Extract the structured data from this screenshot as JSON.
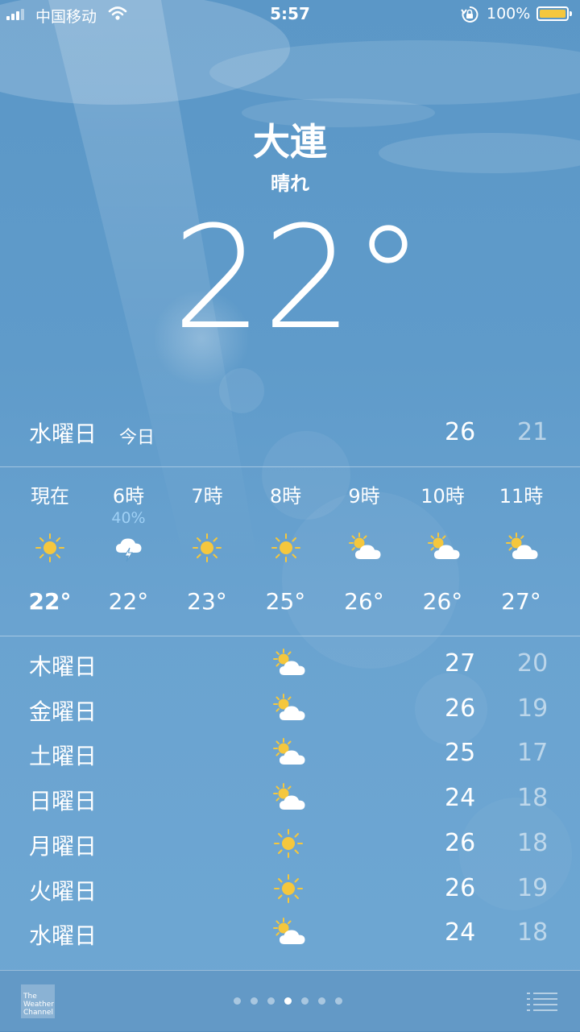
{
  "status_bar": {
    "carrier": "中国移动",
    "time": "5:57",
    "battery_percent": "100%",
    "battery_color": "#f5c73d"
  },
  "location": {
    "city": "大連",
    "condition": "晴れ",
    "temperature": "22°"
  },
  "today": {
    "day": "水曜日",
    "label": "今日",
    "high": "26",
    "low": "21"
  },
  "hourly": [
    {
      "label": "現在",
      "precip": "",
      "icon": "sun-icon",
      "temp": "22°"
    },
    {
      "label": "6時",
      "precip": "40%",
      "icon": "thunderstorm-icon",
      "temp": "22°"
    },
    {
      "label": "7時",
      "precip": "",
      "icon": "sun-icon",
      "temp": "23°"
    },
    {
      "label": "8時",
      "precip": "",
      "icon": "sun-icon",
      "temp": "25°"
    },
    {
      "label": "9時",
      "precip": "",
      "icon": "partly-cloudy-icon",
      "temp": "26°"
    },
    {
      "label": "10時",
      "precip": "",
      "icon": "partly-cloudy-icon",
      "temp": "26°"
    },
    {
      "label": "11時",
      "precip": "",
      "icon": "partly-cloudy-icon",
      "temp": "27°"
    }
  ],
  "daily": [
    {
      "day": "木曜日",
      "icon": "partly-cloudy-icon",
      "high": "27",
      "low": "20"
    },
    {
      "day": "金曜日",
      "icon": "partly-cloudy-icon",
      "high": "26",
      "low": "19"
    },
    {
      "day": "土曜日",
      "icon": "partly-cloudy-icon",
      "high": "25",
      "low": "17"
    },
    {
      "day": "日曜日",
      "icon": "partly-cloudy-icon",
      "high": "24",
      "low": "18"
    },
    {
      "day": "月曜日",
      "icon": "sun-icon",
      "high": "26",
      "low": "18"
    },
    {
      "day": "火曜日",
      "icon": "sun-icon",
      "high": "26",
      "low": "19"
    },
    {
      "day": "水曜日",
      "icon": "partly-cloudy-icon",
      "high": "24",
      "low": "18"
    }
  ],
  "footer": {
    "logo_text": "The Weather Channel",
    "page_count": 7,
    "active_page": 4
  }
}
